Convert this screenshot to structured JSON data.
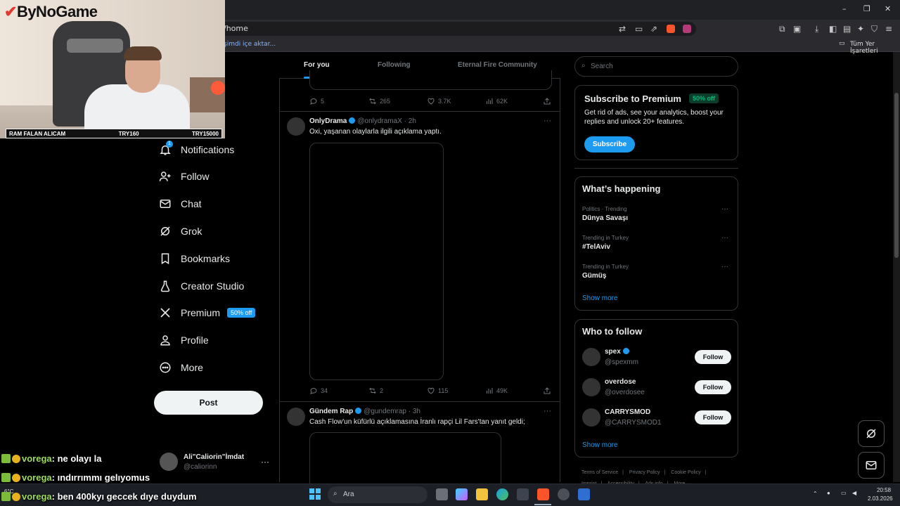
{
  "browser": {
    "url": "/home",
    "bookmark_import": "şimdi içe aktar...",
    "bookmark_all": "Tüm Yer İşaretleri",
    "win_minimize": "–",
    "win_restore": "❐",
    "win_close": "✕"
  },
  "webcam": {
    "logo_mark": "✔",
    "logo_text": "ByNoGame",
    "strip_left": "RAM FALAN ALICAM",
    "strip_mid": "TRY160",
    "strip_right": "TRY15000"
  },
  "nav": {
    "notifications": "Notifications",
    "notifications_badge": "1",
    "follow": "Follow",
    "chat": "Chat",
    "grok": "Grok",
    "bookmarks": "Bookmarks",
    "creator_studio": "Creator Studio",
    "premium": "Premium",
    "premium_badge": "50% off",
    "profile": "Profile",
    "more": "More",
    "post": "Post"
  },
  "account": {
    "name": "Ali\"Caliorin\"İmdat",
    "handle": "@caliorinn",
    "menu": "···"
  },
  "chat_overlay": [
    {
      "nick": "vorega",
      "message": ": ne olayı la"
    },
    {
      "nick": "vorega",
      "message": ": ındırrımmı gelıyomus"
    },
    {
      "nick": "vorega",
      "message": ": ben 400kyı geccek dıye duydum"
    }
  ],
  "tabs": {
    "for_you": "For you",
    "following": "Following",
    "community": "Eternal Fire Community"
  },
  "tweets": [
    {
      "replies": "5",
      "reposts": "265",
      "likes": "3.7K",
      "views": "62K"
    },
    {
      "name": "OnlyDrama",
      "handle": "@onlydramaX",
      "time": "· 2h",
      "text": "Oxi, yaşanan olaylarla ilgili açıklama yaptı.",
      "replies": "34",
      "reposts": "2",
      "likes": "115",
      "views": "49K"
    },
    {
      "name": "Gündem Rap",
      "handle": "@gundemrap",
      "time": "· 3h",
      "text": "Cash Flow'un küfürlü açıklamasına İranlı rapçi Lil Fars'tan yanıt geldi;"
    }
  ],
  "right": {
    "search_placeholder": "Search",
    "premium_title": "Subscribe to Premium",
    "premium_badge": "50% off",
    "premium_desc_1": "Get rid of ads, see your analytics, boost your",
    "premium_desc_2": "replies and unlock 20+ features.",
    "subscribe": "Subscribe",
    "happening_title": "What’s happening",
    "trends": [
      {
        "category": "Politics · Trending",
        "name": "Dünya Savaşı"
      },
      {
        "category": "Trending in Turkey",
        "name": "#TelAviv"
      },
      {
        "category": "Trending in Turkey",
        "name": "Gümüş"
      }
    ],
    "trend_dots": "···",
    "show_more": "Show more",
    "wtf_title": "Who to follow",
    "who_to_follow": [
      {
        "name": "spex",
        "handle": "@spexmm",
        "verified": true
      },
      {
        "name": "overdose",
        "handle": "@overdosee",
        "verified": false
      },
      {
        "name": "CARRYSMOD",
        "handle": "@CARRYSMOD1",
        "verified": false
      }
    ],
    "follow_label": "Follow",
    "wtf_show_more": "Show more",
    "footer": [
      "Terms of Service",
      "|",
      "Privacy Policy",
      "|",
      "Cookie Policy",
      "|",
      "Imprint",
      "|",
      "Accessibility",
      "|",
      "Ads info",
      "|",
      "More ···"
    ]
  },
  "taskbar": {
    "search_placeholder": "Ara",
    "time": "20:58",
    "date": "2.03.2026",
    "weather": "6°C"
  },
  "colors": {
    "accent": "#1d9bf0",
    "premium_green": "#00ba7c",
    "background": "#000000",
    "border": "#2f3336"
  }
}
